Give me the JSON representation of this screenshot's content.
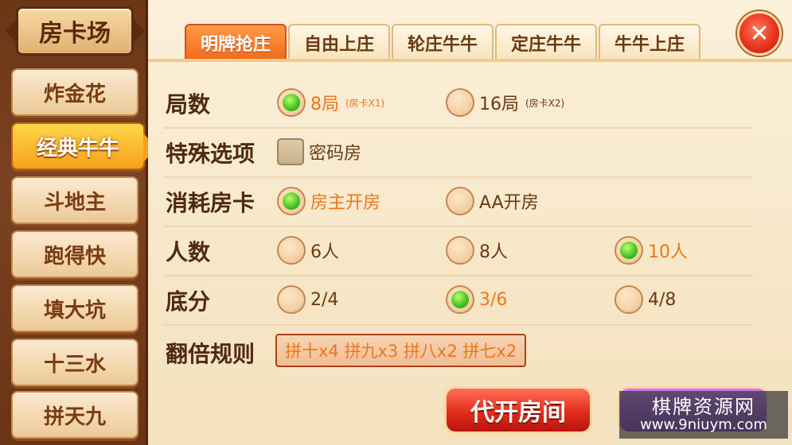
{
  "sidebar": {
    "title": "房卡场",
    "items": [
      {
        "label": "炸金花"
      },
      {
        "label": "经典牛牛",
        "active": true
      },
      {
        "label": "斗地主"
      },
      {
        "label": "跑得快"
      },
      {
        "label": "填大坑"
      },
      {
        "label": "十三水"
      },
      {
        "label": "拼天九"
      }
    ]
  },
  "tabs": [
    {
      "label": "明牌抢庄",
      "active": true
    },
    {
      "label": "自由上庄"
    },
    {
      "label": "轮庄牛牛"
    },
    {
      "label": "定庄牛牛"
    },
    {
      "label": "牛牛上庄"
    }
  ],
  "close_icon": "close-x-icon",
  "rows": {
    "rounds": {
      "label": "局数",
      "options": [
        {
          "text": "8局",
          "sub": "(房卡X1)",
          "selected": true
        },
        {
          "text": "16局",
          "sub": "(房卡X2)",
          "selected": false
        }
      ]
    },
    "special": {
      "label": "特殊选项",
      "options": [
        {
          "text": "密码房",
          "checked": false
        }
      ]
    },
    "cost": {
      "label": "消耗房卡",
      "options": [
        {
          "text": "房主开房",
          "selected": true
        },
        {
          "text": "AA开房",
          "selected": false
        }
      ]
    },
    "players": {
      "label": "人数",
      "options": [
        {
          "text": "6人",
          "selected": false
        },
        {
          "text": "8人",
          "selected": false
        },
        {
          "text": "10人",
          "selected": true
        }
      ]
    },
    "base_score": {
      "label": "底分",
      "options": [
        {
          "text": "2/4",
          "selected": false
        },
        {
          "text": "3/6",
          "selected": true
        },
        {
          "text": "4/8",
          "selected": false
        }
      ]
    },
    "multiplier": {
      "label": "翻倍规则",
      "value": "拼十x4 拼九x3 拼八x2 拼七x2"
    }
  },
  "buttons": {
    "proxy_open": "代开房间"
  },
  "watermark": {
    "line1": "棋牌资源网",
    "line2": "www.9niuym.com"
  },
  "colors": {
    "selected_text": "#f0761c",
    "active_tab": "#f06a1c",
    "radio_on": "#3fc021"
  }
}
